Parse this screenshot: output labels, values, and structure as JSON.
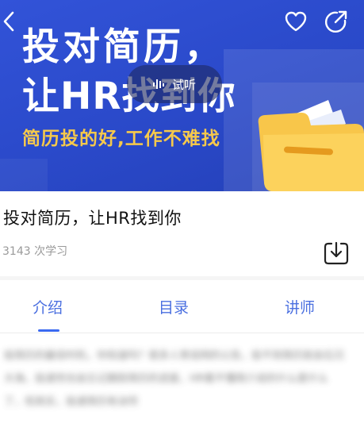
{
  "banner": {
    "title_line1": "投对简历，",
    "title_line2": "让HR找到你",
    "tagline": "简历投的好,工作不难找",
    "audio_label": "试听"
  },
  "course": {
    "title": "投对简历，让HR找到你",
    "stats": "3143 次学习"
  },
  "tabs": [
    {
      "label": "介绍",
      "active": true
    },
    {
      "label": "目录",
      "active": false
    },
    {
      "label": "讲师",
      "active": false
    }
  ],
  "intro_blurred": "投简历的最佳时机，你知道吗？很多人常说网的公告，投不到简历就会石沉大海，投递完也会忘记跟踪简历的进度，HR看不懂简介说的什么是什么了，但其实，投递简历有诀窍",
  "icons": {
    "back": "chevron-left-icon",
    "favorite": "heart-icon",
    "share": "share-icon",
    "audio": "audio-wave-icon",
    "download": "download-icon"
  },
  "colors": {
    "banner_blue": "#2a49c9",
    "tagline_yellow": "#f6c94b",
    "accent_blue": "#3b6af0",
    "folder_yellow": "#f8c64a"
  }
}
